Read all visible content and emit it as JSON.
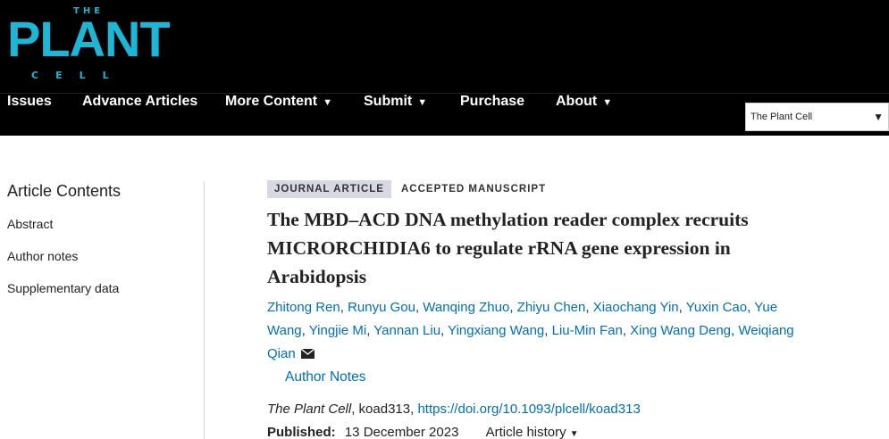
{
  "logo": {
    "the": "THE",
    "plant": "PLANT",
    "cell": "CELL"
  },
  "nav": {
    "items": [
      {
        "label": "Issues",
        "caret": ""
      },
      {
        "label": "Advance Articles",
        "caret": ""
      },
      {
        "label": "More Content",
        "caret": "▼"
      },
      {
        "label": "Submit",
        "caret": "▼"
      },
      {
        "label": "Purchase",
        "caret": ""
      },
      {
        "label": "About",
        "caret": "▼"
      }
    ],
    "journal_select": {
      "value": "The Plant Cell",
      "caret": "▼"
    }
  },
  "sidebar": {
    "title": "Article Contents",
    "items": [
      "Abstract",
      "Author notes",
      "Supplementary data"
    ]
  },
  "article": {
    "type_badge": "JOURNAL ARTICLE",
    "status_badge": "ACCEPTED MANUSCRIPT",
    "title": "The MBD–ACD DNA methylation reader complex recruits MICRORCHIDIA6 to regulate rRNA gene expression in Arabidopsis",
    "authors": [
      "Zhitong Ren",
      "Runyu Gou",
      "Wanqing Zhuo",
      "Zhiyu Chen",
      "Xiaochang Yin",
      "Yuxin Cao",
      "Yue Wang",
      "Yingjie Mi",
      "Yannan Liu",
      "Yingxiang Wang",
      "Liu-Min Fan",
      "Xing Wang Deng",
      "Weiqiang Qian"
    ],
    "author_notes": "Author Notes",
    "journal_name": "The Plant Cell",
    "article_id": ", koad313, ",
    "doi": "https://doi.org/10.1093/plcell/koad313",
    "published_label": "Published:",
    "published_date": "13 December 2023",
    "history_label": "Article history",
    "history_caret": "▼"
  },
  "colors": {
    "logo": "#1fb6d6",
    "link": "#006fb7",
    "header_bg": "#000000",
    "badge_bg": "#d6d9e3"
  },
  "icons": {
    "mail": "envelope-icon"
  }
}
